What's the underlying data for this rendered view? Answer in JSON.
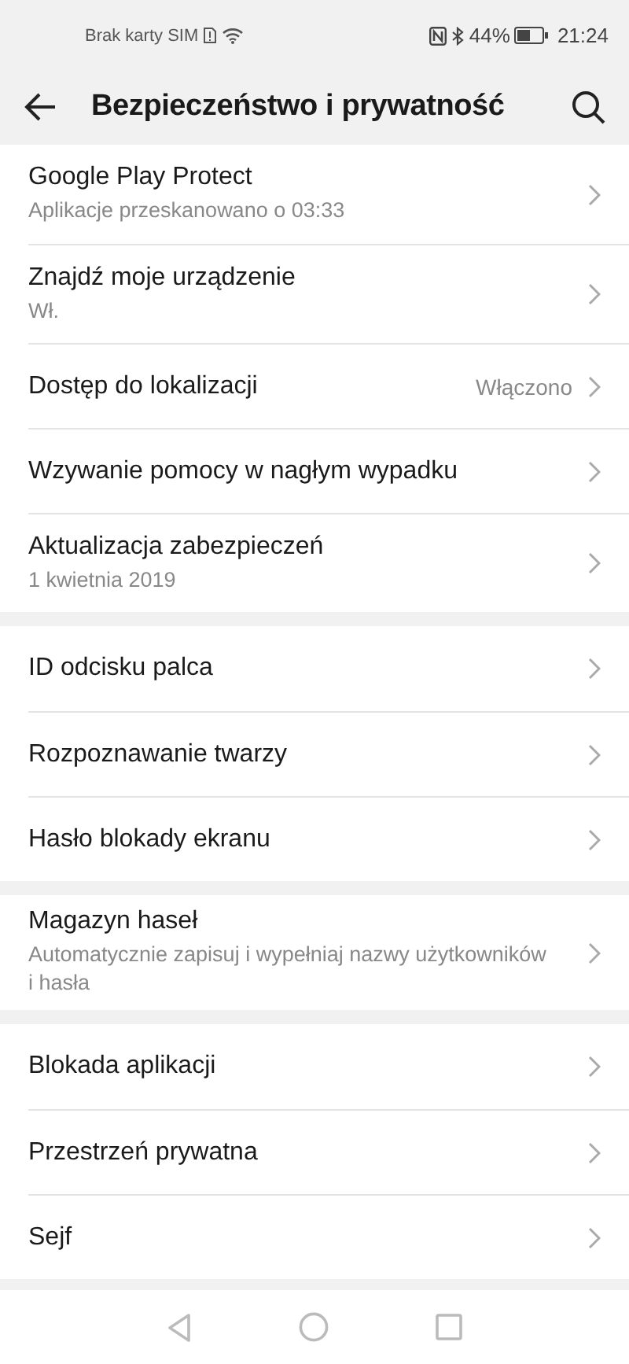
{
  "status_bar": {
    "carrier": "Brak karty SIM",
    "battery_percent": "44%",
    "time": "21:24"
  },
  "header": {
    "title": "Bezpieczeństwo i prywatność"
  },
  "groups": [
    {
      "items": [
        {
          "title": "Google Play Protect",
          "subtitle": "Aplikacje przeskanowano o 03:33"
        },
        {
          "title": "Znajdź moje urządzenie",
          "subtitle": "Wł."
        },
        {
          "title": "Dostęp do lokalizacji",
          "value": "Włączono"
        },
        {
          "title": "Wzywanie pomocy w nagłym wypadku"
        },
        {
          "title": "Aktualizacja zabezpieczeń",
          "subtitle": "1 kwietnia 2019"
        }
      ]
    },
    {
      "items": [
        {
          "title": "ID odcisku palca"
        },
        {
          "title": "Rozpoznawanie twarzy"
        },
        {
          "title": "Hasło blokady ekranu"
        }
      ]
    },
    {
      "items": [
        {
          "title": "Magazyn haseł",
          "subtitle": "Automatycznie zapisuj i wypełniaj nazwy użytkowników i hasła"
        }
      ]
    },
    {
      "items": [
        {
          "title": "Blokada aplikacji"
        },
        {
          "title": "Przestrzeń prywatna"
        },
        {
          "title": "Sejf"
        }
      ]
    }
  ]
}
